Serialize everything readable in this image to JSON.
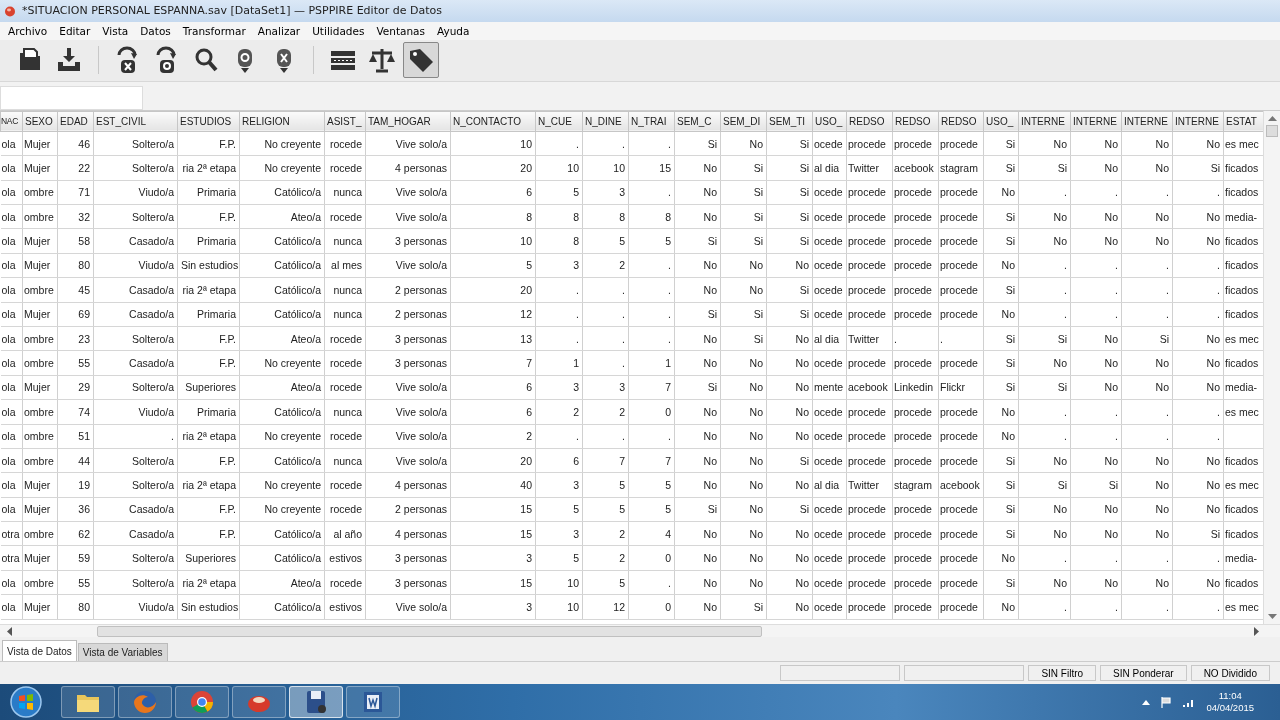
{
  "window": {
    "title": "*SITUACION PERSONAL ESPANNA.sav [DataSet1] — PSPPIRE Editor de Datos"
  },
  "menu": [
    "Archivo",
    "Editar",
    "Vista",
    "Datos",
    "Transformar",
    "Analizar",
    "Utilidades",
    "Ventanas",
    "Ayuda"
  ],
  "toolbar": [
    {
      "selected": false
    },
    {
      "selected": false
    },
    {
      "selected": false
    },
    {
      "selected": false
    },
    {
      "selected": false
    },
    {
      "selected": false
    },
    {
      "selected": false
    },
    {
      "selected": false
    },
    {
      "selected": false
    },
    {
      "selected": true
    }
  ],
  "table": {
    "columns": [
      "NAC",
      "SEXO",
      "EDAD",
      "EST_CIVIL",
      "ESTUDIOS",
      "RELIGION",
      "ASIST_",
      "TAM_HOGAR",
      "N_CONTACTO",
      "N_CUE",
      "N_DINE",
      "N_TRAI",
      "SEM_C",
      "SEM_DI",
      "SEM_TI",
      "USO_",
      "REDSO",
      "REDSO",
      "REDSO",
      "USO_",
      "INTERNE",
      "INTERNE",
      "INTERNE",
      "INTERNE",
      "ESTAT"
    ],
    "rows": [
      [
        "ola",
        "Mujer",
        "46",
        "Soltero/a",
        "F.P.",
        "No creyente",
        "rocede",
        "Vive solo/a",
        "10",
        ".",
        ".",
        ".",
        "Si",
        "No",
        "Si",
        "ocede",
        "procede",
        "procede",
        "procede",
        "Si",
        "No",
        "No",
        "No",
        "No",
        "es mec"
      ],
      [
        "ola",
        "Mujer",
        "22",
        "Soltero/a",
        "ria 2ª etapa",
        "No creyente",
        "rocede",
        "4 personas",
        "20",
        "10",
        "10",
        "15",
        "No",
        "Si",
        "Si",
        "al dia",
        "Twitter",
        "acebook",
        "stagram",
        "Si",
        "Si",
        "No",
        "No",
        "Si",
        "ficados"
      ],
      [
        "ola",
        "ombre",
        "71",
        "Viudo/a",
        "Primaria",
        "Católico/a",
        "nunca",
        "Vive solo/a",
        "6",
        "5",
        "3",
        ".",
        "No",
        "Si",
        "Si",
        "ocede",
        "procede",
        "procede",
        "procede",
        "No",
        ".",
        ".",
        ".",
        ".",
        "ficados"
      ],
      [
        "ola",
        "ombre",
        "32",
        "Soltero/a",
        "F.P.",
        "Ateo/a",
        "rocede",
        "Vive solo/a",
        "8",
        "8",
        "8",
        "8",
        "No",
        "Si",
        "Si",
        "ocede",
        "procede",
        "procede",
        "procede",
        "Si",
        "No",
        "No",
        "No",
        "No",
        "media-"
      ],
      [
        "ola",
        "Mujer",
        "58",
        "Casado/a",
        "Primaria",
        "Católico/a",
        "nunca",
        "3 personas",
        "10",
        "8",
        "5",
        "5",
        "Si",
        "Si",
        "Si",
        "ocede",
        "procede",
        "procede",
        "procede",
        "Si",
        "No",
        "No",
        "No",
        "No",
        "ficados"
      ],
      [
        "ola",
        "Mujer",
        "80",
        "Viudo/a",
        "Sin estudios",
        "Católico/a",
        "al mes",
        "Vive solo/a",
        "5",
        "3",
        "2",
        ".",
        "No",
        "No",
        "No",
        "ocede",
        "procede",
        "procede",
        "procede",
        "No",
        ".",
        ".",
        ".",
        ".",
        "ficados"
      ],
      [
        "ola",
        "ombre",
        "45",
        "Casado/a",
        "ria 2ª etapa",
        "Católico/a",
        "nunca",
        "2 personas",
        "20",
        ".",
        ".",
        ".",
        "No",
        "No",
        "Si",
        "ocede",
        "procede",
        "procede",
        "procede",
        "Si",
        ".",
        ".",
        ".",
        ".",
        "ficados"
      ],
      [
        "ola",
        "Mujer",
        "69",
        "Casado/a",
        "Primaria",
        "Católico/a",
        "nunca",
        "2 personas",
        "12",
        ".",
        ".",
        ".",
        "Si",
        "Si",
        "Si",
        "ocede",
        "procede",
        "procede",
        "procede",
        "No",
        ".",
        ".",
        ".",
        ".",
        "ficados"
      ],
      [
        "ola",
        "ombre",
        "23",
        "Soltero/a",
        "F.P.",
        "Ateo/a",
        "rocede",
        "3 personas",
        "13",
        ".",
        ".",
        ".",
        "No",
        "Si",
        "No",
        "al dia",
        "Twitter",
        ".",
        ".",
        "Si",
        "Si",
        "No",
        "Si",
        "No",
        "es mec"
      ],
      [
        "ola",
        "ombre",
        "55",
        "Casado/a",
        "F.P.",
        "No creyente",
        "rocede",
        "3 personas",
        "7",
        "1",
        ".",
        "1",
        "No",
        "No",
        "No",
        "ocede",
        "procede",
        "procede",
        "procede",
        "Si",
        "No",
        "No",
        "No",
        "No",
        "ficados"
      ],
      [
        "ola",
        "Mujer",
        "29",
        "Soltero/a",
        "Superiores",
        "Ateo/a",
        "rocede",
        "Vive solo/a",
        "6",
        "3",
        "3",
        "7",
        "Si",
        "No",
        "No",
        "mente",
        "acebook",
        "Linkedin",
        "Flickr",
        "Si",
        "Si",
        "No",
        "No",
        "No",
        "media-"
      ],
      [
        "ola",
        "ombre",
        "74",
        "Viudo/a",
        "Primaria",
        "Católico/a",
        "nunca",
        "Vive solo/a",
        "6",
        "2",
        "2",
        "0",
        "No",
        "No",
        "No",
        "ocede",
        "procede",
        "procede",
        "procede",
        "No",
        ".",
        ".",
        ".",
        ".",
        "es mec"
      ],
      [
        "ola",
        "ombre",
        "51",
        ".",
        "ria 2ª etapa",
        "No creyente",
        "rocede",
        "Vive solo/a",
        "2",
        ".",
        ".",
        ".",
        "No",
        "No",
        "No",
        "ocede",
        "procede",
        "procede",
        "procede",
        "No",
        ".",
        ".",
        ".",
        ".",
        null
      ],
      [
        "ola",
        "ombre",
        "44",
        "Soltero/a",
        "F.P.",
        "Católico/a",
        "nunca",
        "Vive solo/a",
        "20",
        "6",
        "7",
        "7",
        "No",
        "No",
        "Si",
        "ocede",
        "procede",
        "procede",
        "procede",
        "Si",
        "No",
        "No",
        "No",
        "No",
        "ficados"
      ],
      [
        "ola",
        "Mujer",
        "19",
        "Soltero/a",
        "ria 2ª etapa",
        "No creyente",
        "rocede",
        "4 personas",
        "40",
        "3",
        "5",
        "5",
        "No",
        "No",
        "No",
        "al dia",
        "Twitter",
        "stagram",
        "acebook",
        "Si",
        "Si",
        "Si",
        "No",
        "No",
        "es mec"
      ],
      [
        "ola",
        "Mujer",
        "36",
        "Casado/a",
        "F.P.",
        "No creyente",
        "rocede",
        "2 personas",
        "15",
        "5",
        "5",
        "5",
        "Si",
        "No",
        "Si",
        "ocede",
        "procede",
        "procede",
        "procede",
        "Si",
        "No",
        "No",
        "No",
        "No",
        "ficados"
      ],
      [
        "otra",
        "ombre",
        "62",
        "Casado/a",
        "F.P.",
        "Católico/a",
        "al año",
        "4 personas",
        "15",
        "3",
        "2",
        "4",
        "No",
        "No",
        "No",
        "ocede",
        "procede",
        "procede",
        "procede",
        "Si",
        "No",
        "No",
        "No",
        "Si",
        "ficados"
      ],
      [
        "otra",
        "Mujer",
        "59",
        "Soltero/a",
        "Superiores",
        "Católico/a",
        "estivos",
        "3 personas",
        "3",
        "5",
        "2",
        "0",
        "No",
        "No",
        "No",
        "ocede",
        "procede",
        "procede",
        "procede",
        "No",
        ".",
        ".",
        ".",
        ".",
        "media-"
      ],
      [
        "ola",
        "ombre",
        "55",
        "Soltero/a",
        "ria 2ª etapa",
        "Ateo/a",
        "rocede",
        "3 personas",
        "15",
        "10",
        "5",
        ".",
        "No",
        "No",
        "No",
        "ocede",
        "procede",
        "procede",
        "procede",
        "Si",
        "No",
        "No",
        "No",
        "No",
        "ficados"
      ],
      [
        "ola",
        "Mujer",
        "80",
        "Viudo/a",
        "Sin estudios",
        "Católico/a",
        "estivos",
        "Vive solo/a",
        "3",
        "10",
        "12",
        "0",
        "No",
        "Si",
        "No",
        "ocede",
        "procede",
        "procede",
        "procede",
        "No",
        ".",
        ".",
        ".",
        ".",
        "es mec"
      ]
    ]
  },
  "view_tabs": [
    {
      "label": "Vista de Datos",
      "selected": true
    },
    {
      "label": "Vista de Variables",
      "selected": false
    }
  ],
  "status_bar": [
    "SIN Filtro",
    "SIN Ponderar",
    "NO Dividido"
  ],
  "taskbar": {
    "buttons": [
      {
        "selected": false
      },
      {
        "selected": false
      },
      {
        "selected": false
      },
      {
        "selected": false
      },
      {
        "selected": true
      },
      {
        "selected": false
      }
    ],
    "time": "11:04",
    "date": "04/04/2015"
  }
}
